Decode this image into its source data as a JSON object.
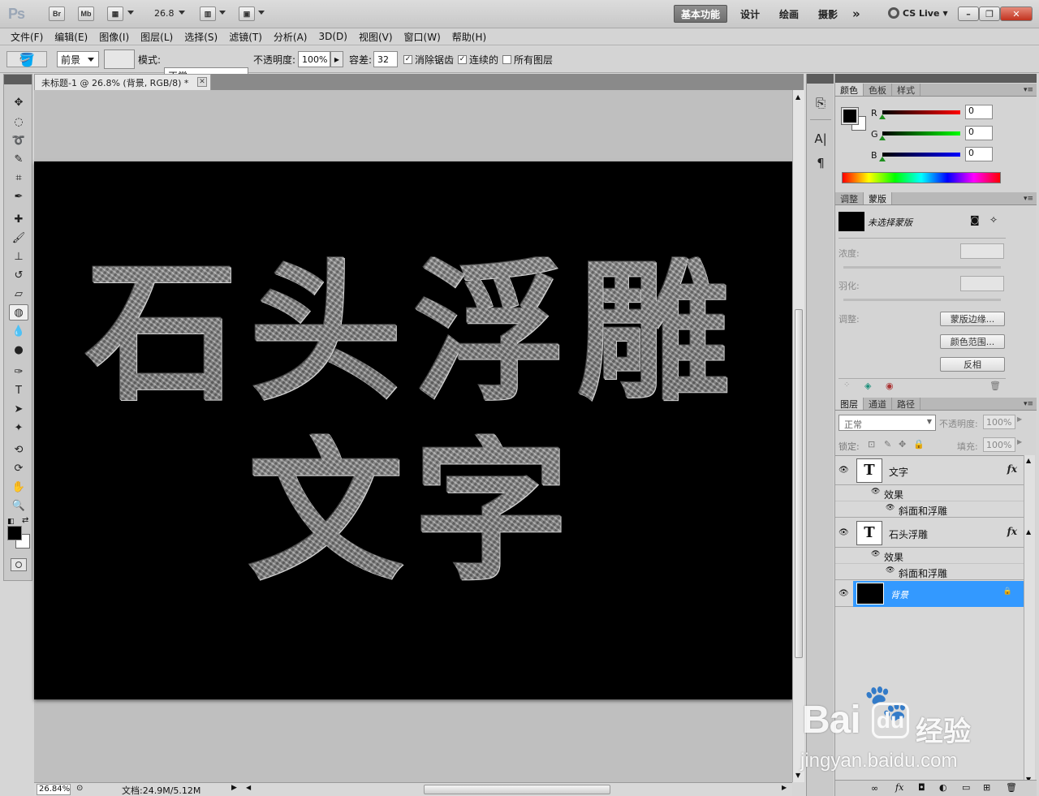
{
  "appbar": {
    "logo": "Ps",
    "bridge": "Br",
    "minibridge": "Mb",
    "zoom": "26.8",
    "workspaces": [
      "基本功能",
      "设计",
      "绘画",
      "摄影"
    ],
    "more": "»",
    "cslive": "CS Live"
  },
  "menu": [
    "文件(F)",
    "编辑(E)",
    "图像(I)",
    "图层(L)",
    "选择(S)",
    "滤镜(T)",
    "分析(A)",
    "3D(D)",
    "视图(V)",
    "窗口(W)",
    "帮助(H)"
  ],
  "options": {
    "fill_source": "前景",
    "mode_label": "模式:",
    "mode_value": "正常",
    "opacity_label": "不透明度:",
    "opacity_value": "100%",
    "tolerance_label": "容差:",
    "tolerance_value": "32",
    "antialias_label": "消除锯齿",
    "contiguous_label": "连续的",
    "all_layers_label": "所有图层"
  },
  "document": {
    "tab_title": "未标题-1 @ 26.8% (背景, RGB/8) *",
    "line1": "石头浮雕",
    "line2": "文字",
    "zoom": "26.84%",
    "doc_size": "文档:24.9M/5.12M"
  },
  "color_panel": {
    "tabs": [
      "颜色",
      "色板",
      "样式"
    ],
    "r_label": "R",
    "g_label": "G",
    "b_label": "B",
    "r": "0",
    "g": "0",
    "b": "0"
  },
  "masks_panel": {
    "tabs": [
      "调整",
      "蒙版"
    ],
    "no_mask": "未选择蒙版",
    "density": "浓度:",
    "feather": "羽化:",
    "refine": "调整:",
    "mask_edge_btn": "蒙版边缘...",
    "color_range_btn": "颜色范围...",
    "invert_btn": "反相"
  },
  "layers_panel": {
    "tabs": [
      "图层",
      "通道",
      "路径"
    ],
    "blend_mode": "正常",
    "opacity_label": "不透明度:",
    "opacity_value": "100%",
    "lock_label": "锁定:",
    "fill_label": "填充:",
    "fill_value": "100%",
    "layers": [
      {
        "name": "文字",
        "effects_label": "效果",
        "effect": "斜面和浮雕"
      },
      {
        "name": "石头浮雕",
        "effects_label": "效果",
        "effect": "斜面和浮雕"
      },
      {
        "name": "背景"
      }
    ]
  },
  "watermark": {
    "brand": "Bai",
    "brand_cn": "经验",
    "url": "jingyan.baidu.com"
  },
  "colors": {
    "accent_selected": "#3399ff",
    "workspace_active": "#7a7a7a"
  }
}
